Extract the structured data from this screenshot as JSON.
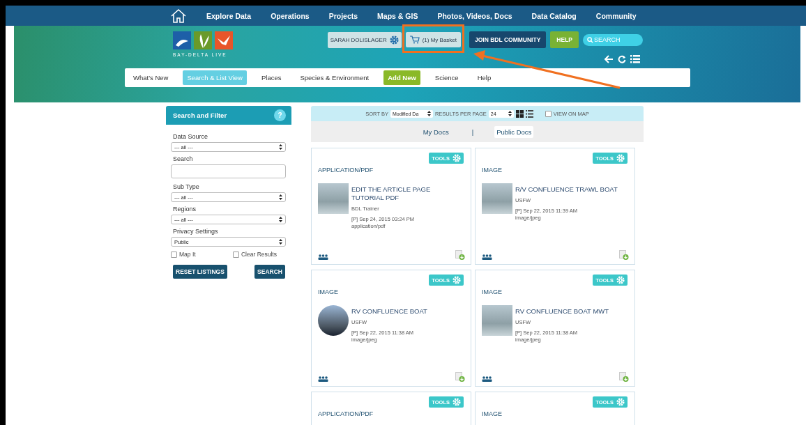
{
  "top_nav": {
    "items": [
      "Explore Data",
      "Operations",
      "Projects",
      "Maps & GIS",
      "Photos, Videos, Docs",
      "Data Catalog",
      "Community"
    ]
  },
  "header": {
    "logo_text": "BAY-DELTA LIVE",
    "user": "SARAH DOLISLAGER",
    "basket": "(1) My Basket",
    "join": "JOIN BDL COMMUNITY",
    "help": "HELP",
    "search": {
      "placeholder": "SEARCH"
    }
  },
  "sub_nav": [
    {
      "label": "What's New",
      "selected": false,
      "kind": "link"
    },
    {
      "label": "Search & List View",
      "selected": true,
      "kind": "link"
    },
    {
      "label": "Places",
      "selected": false,
      "kind": "link"
    },
    {
      "label": "Species & Environment",
      "selected": false,
      "kind": "link"
    },
    {
      "label": "Add New",
      "selected": false,
      "kind": "accent"
    },
    {
      "label": "Science",
      "selected": false,
      "kind": "link"
    },
    {
      "label": "Help",
      "selected": false,
      "kind": "link"
    }
  ],
  "sidebar": {
    "title": "Search and Filter",
    "help": "?",
    "fields": [
      {
        "label": "Data Source",
        "kind": "select",
        "value": "--- all ---"
      },
      {
        "label": "Search",
        "kind": "text"
      },
      {
        "label": "Sub Type",
        "kind": "select",
        "value": "--- all ---"
      },
      {
        "label": "Regions",
        "kind": "select",
        "value": "--- all ---"
      },
      {
        "label": "Privacy Settings",
        "kind": "select",
        "value": "Public"
      }
    ],
    "checkboxes": [
      {
        "label": "Map It",
        "checked": false
      },
      {
        "label": "Clear Results",
        "checked": false
      }
    ],
    "buttons": [
      "RESET LISTINGS",
      "SEARCH"
    ]
  },
  "toolbar": {
    "sort_label": "SORT BY",
    "sort_value": "Modified Da",
    "per_page_label": "RESULTS PER PAGE",
    "per_page_value": "24",
    "view_on_map": {
      "label": "VIEW ON MAP",
      "checked": false
    }
  },
  "doc_tabs": [
    {
      "label": "My Docs",
      "selected": false
    },
    {
      "label": "Public Docs",
      "selected": true
    }
  ],
  "doc_tab_separator": "|",
  "cards": [
    {
      "tools": "TOOLS",
      "type": "APPLICATION/PDF",
      "kind": "square",
      "title": "EDIT THE ARTICLE PAGE TUTORIAL PDF",
      "author": "BDL Trainer",
      "date": "[P] Sep 24, 2015 03:24 PM",
      "mime": "application/pdf"
    },
    {
      "tools": "TOOLS",
      "type": "IMAGE",
      "kind": "square",
      "title": "R/V CONFLUENCE TRAWL BOAT",
      "author": "USFW",
      "date": "[P] Sep 22, 2015 11:39 AM",
      "mime": "image/jpeg"
    },
    {
      "tools": "TOOLS",
      "type": "IMAGE",
      "kind": "round",
      "title": "RV CONFLUENCE BOAT",
      "author": "USFW",
      "date": "[P] Sep 22, 2015 11:38 AM",
      "mime": "image/jpeg"
    },
    {
      "tools": "TOOLS",
      "type": "IMAGE",
      "kind": "square",
      "title": "RV CONFLUENCE BOAT MWT",
      "author": "USFW",
      "date": "[P] Sep 22, 2015 11:38 AM",
      "mime": "image/jpeg"
    },
    {
      "tools": "TOOLS",
      "type": "APPLICATION/PDF"
    },
    {
      "tools": "TOOLS",
      "type": "IMAGE"
    }
  ]
}
